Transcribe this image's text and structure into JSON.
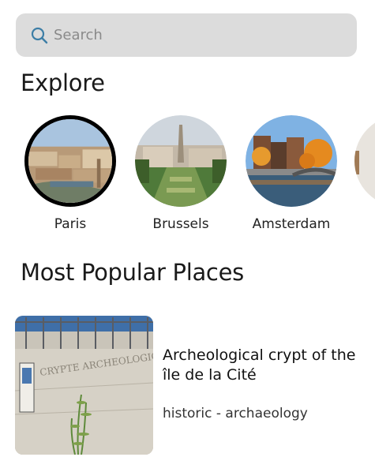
{
  "search": {
    "placeholder": "Search",
    "value": ""
  },
  "explore": {
    "title": "Explore",
    "cities": [
      {
        "name": "Paris",
        "selected": true
      },
      {
        "name": "Brussels",
        "selected": false
      },
      {
        "name": "Amsterdam",
        "selected": false
      }
    ]
  },
  "popular": {
    "title": "Most Popular Places",
    "places": [
      {
        "name": "Archeological crypt of the île de la Cité",
        "category": "historic - archaeology",
        "sign_text": "CRYPTE ARCHEOLOGIQUE"
      }
    ]
  },
  "colors": {
    "search_bg": "#dcdcdc",
    "search_icon": "#3d7ea6",
    "selected_ring": "#000000"
  },
  "icons": {
    "search": "search-icon"
  }
}
